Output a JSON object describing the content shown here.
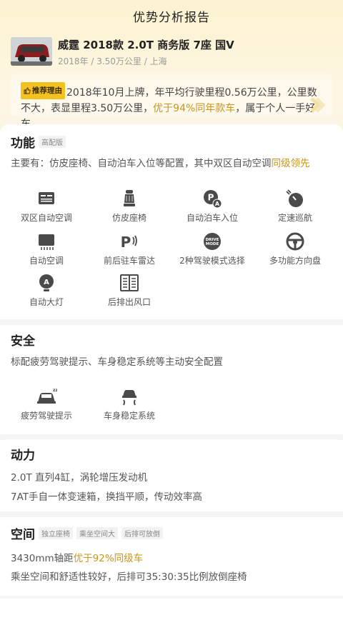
{
  "page_title": "优势分析报告",
  "car": {
    "name": "威霆 2018款 2.0T 商务版 7座 国V",
    "meta": "2018年 / 3.50万公里 / 上海"
  },
  "reason": {
    "badge": "推荐理由",
    "text_1": "2018年10月上牌，年平均行驶里程0.56万公里，公里数不大，表显里程3.50万公里，",
    "highlight": "优于94%同年款车",
    "text_2": "，属于个人一手好车"
  },
  "features_section": {
    "title": "功能",
    "tag": "高配版",
    "desc_prefix": "主要有：仿皮座椅、自动泊车入位等配置，其中双区自动空调",
    "desc_highlight": "同级领先",
    "items": [
      {
        "icon": "dual-zone-ac-icon",
        "label": "双区自动空调"
      },
      {
        "icon": "leather-seat-icon",
        "label": "仿皮座椅"
      },
      {
        "icon": "auto-park-icon",
        "label": "自动泊车入位"
      },
      {
        "icon": "cruise-control-icon",
        "label": "定速巡航"
      },
      {
        "icon": "auto-ac-icon",
        "label": "自动空调"
      },
      {
        "icon": "parking-radar-icon",
        "label": "前后驻车雷达"
      },
      {
        "icon": "drive-mode-icon",
        "label": "2种驾驶模式选择"
      },
      {
        "icon": "steering-wheel-icon",
        "label": "多功能方向盘"
      },
      {
        "icon": "auto-headlight-icon",
        "label": "自动大灯"
      },
      {
        "icon": "rear-vent-icon",
        "label": "后排出风口"
      }
    ]
  },
  "safety_section": {
    "title": "安全",
    "desc": "标配疲劳驾驶提示、车身稳定系统等主动安全配置",
    "items": [
      {
        "icon": "fatigue-alert-icon",
        "label": "疲劳驾驶提示"
      },
      {
        "icon": "stability-control-icon",
        "label": "车身稳定系统"
      }
    ]
  },
  "power_section": {
    "title": "动力",
    "line_1": "2.0T 直列4缸，涡轮增压发动机",
    "line_2": "7AT手自一体变速箱，换挡平顺，传动效率高"
  },
  "space_section": {
    "title": "空间",
    "tags": [
      "独立座椅",
      "乘坐空间大",
      "后排可放倒"
    ],
    "line_1_prefix": "3430mm轴距",
    "line_1_highlight": "优于92%同级车",
    "line_2": "乘坐空间和舒适性较好，后排可35:30:35比例放倒座椅"
  },
  "colors": {
    "accent": "#c9961a",
    "badge": "#f4c21e"
  }
}
